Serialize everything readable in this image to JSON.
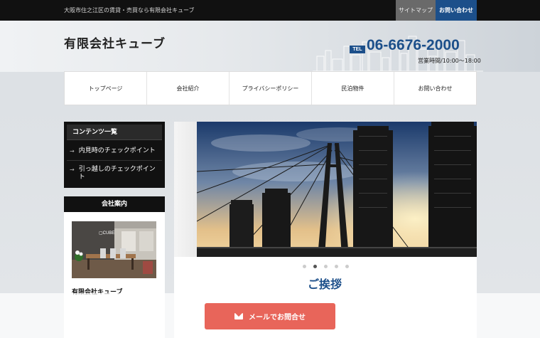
{
  "topbar": {
    "tagline": "大阪市住之江区の賃貸・売買なら有限会社キューブ",
    "sitemap_label": "サイトマップ",
    "contact_label": "お問い合わせ"
  },
  "header": {
    "company_name": "有限会社キューブ",
    "tel_badge": "TEL",
    "tel_number": "06-6676-2000",
    "hours": "営業時間/10:00～18:00"
  },
  "nav": {
    "items": [
      {
        "label": "トップページ"
      },
      {
        "label": "会社紹介"
      },
      {
        "label": "プライバシーポリシー"
      },
      {
        "label": "民泊物件"
      },
      {
        "label": "お問い合わせ"
      }
    ]
  },
  "sidebar": {
    "contents_title": "コンテンツ一覧",
    "links": [
      {
        "label": "内見時のチェックポイント"
      },
      {
        "label": "引っ越しのチェックポイント"
      }
    ],
    "company_title": "会社案内",
    "company_name": "有限会社キューブ"
  },
  "main": {
    "greeting": "ご挨拶",
    "slider_dots": 5,
    "active_dot": 1
  },
  "cta": {
    "mail_label": "メールでお問合せ"
  },
  "colors": {
    "brand_blue": "#1c4f8a",
    "cta_coral": "#e8655a",
    "dark": "#111111"
  }
}
